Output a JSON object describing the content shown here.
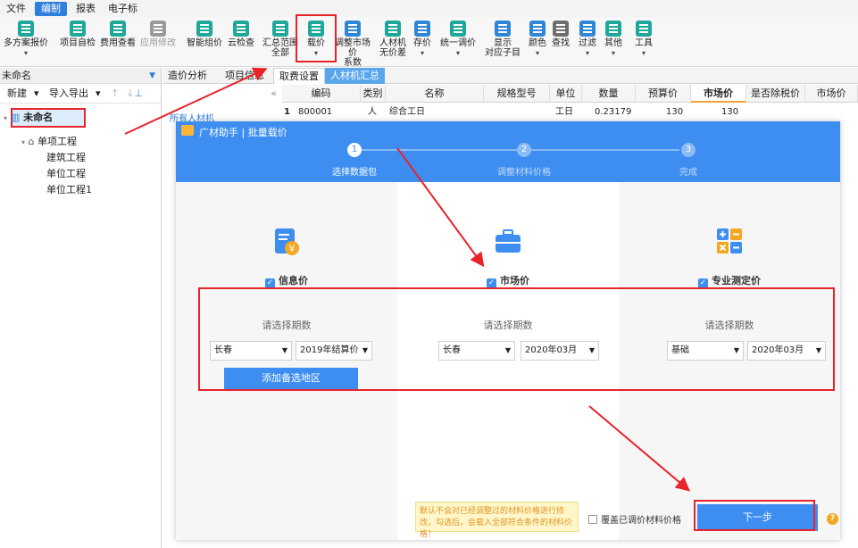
{
  "menu": {
    "items": [
      "文件",
      "编制",
      "报表",
      "电子标"
    ]
  },
  "ribbon": {
    "buttons": [
      {
        "label": "多方案报价"
      },
      {
        "label": "项目自检"
      },
      {
        "label": "费用查看"
      },
      {
        "label": "应用修改"
      },
      {
        "label": "智能组价"
      },
      {
        "label": "云检查"
      },
      {
        "label": "汇总范围",
        "label2": "全部"
      },
      {
        "label": "载价"
      },
      {
        "label": "调整市场价",
        "label2": "系数"
      },
      {
        "label": "人材机",
        "label2": "无价差"
      },
      {
        "label": "存价"
      },
      {
        "label": "统一调价"
      },
      {
        "label": "显示",
        "label2": "对应子目"
      },
      {
        "label": "颜色"
      },
      {
        "label": "查找"
      },
      {
        "label": "过滤"
      },
      {
        "label": "其他"
      },
      {
        "label": "工具"
      }
    ]
  },
  "sidebar": {
    "project": "未命名",
    "tools": {
      "new": "新建",
      "import_export": "导入导出"
    },
    "tree": [
      {
        "label": "未命名"
      },
      {
        "label": "单项工程"
      },
      {
        "label": "建筑工程"
      },
      {
        "label": "单位工程"
      },
      {
        "label": "单位工程1"
      }
    ]
  },
  "tabs": [
    "造价分析",
    "项目信息",
    "取费设置",
    "人材机汇总"
  ],
  "grid": {
    "tree_label": "所有人材机",
    "headers": [
      "编码",
      "类别",
      "名称",
      "规格型号",
      "单位",
      "数量",
      "预算价",
      "市场价",
      "是否除税价",
      "市场价"
    ],
    "row": {
      "index": "1",
      "code": "800001",
      "type": "人",
      "name": "综合工日",
      "unit": "工日",
      "qty": "0.23179",
      "budget": "130",
      "market": "130"
    }
  },
  "dialog": {
    "title": "广材助手 | 批量载价",
    "steps": [
      {
        "num": "1",
        "label": "选择数据包"
      },
      {
        "num": "2",
        "label": "调整材料价格"
      },
      {
        "num": "3",
        "label": "完成"
      }
    ],
    "columns": [
      {
        "title": "信息价",
        "sub": "请选择期数",
        "region": "长春",
        "period": "2019年结算价",
        "add_button": "添加备选地区"
      },
      {
        "title": "市场价",
        "sub": "请选择期数",
        "region": "长春",
        "period": "2020年03月"
      },
      {
        "title": "专业测定价",
        "sub": "请选择期数",
        "region": "基础",
        "period": "2020年03月"
      }
    ],
    "tip": "默认不会对已经调整过的材料价格进行修改，勾选后，会载入全部符合条件的材料价格！",
    "overwrite_label": "覆盖已调价材料价格",
    "next_label": "下一步"
  },
  "colors": {
    "accent": "#3d8ef0",
    "highlight": "#e8232a"
  }
}
